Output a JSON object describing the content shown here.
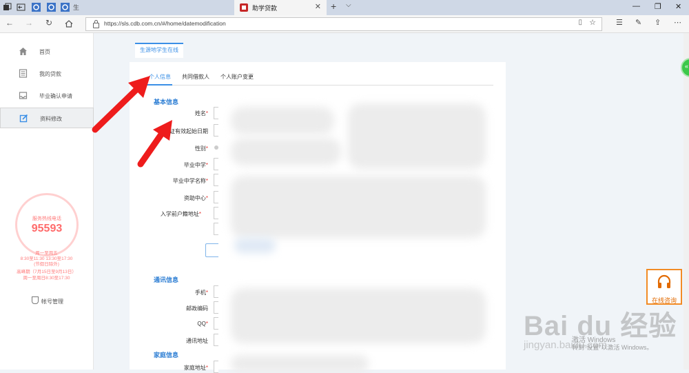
{
  "browser": {
    "active_tab_title": "助学贷款",
    "blurred_tab_label": "生",
    "url": "https://sls.cdb.com.cn/#/home/datemodification"
  },
  "sidebar": {
    "items": [
      {
        "label": "首页",
        "icon": "home-icon"
      },
      {
        "label": "我的贷款",
        "icon": "document-icon"
      },
      {
        "label": "毕业确认申请",
        "icon": "inbox-icon"
      },
      {
        "label": "资料修改",
        "icon": "edit-icon",
        "active": true
      }
    ],
    "hotline_label": "服务热线电话",
    "hotline_number": "95593",
    "hours": [
      "周一至周五",
      "8:30至11:30 13:30至17:30",
      "(节假日除外)",
      "高峰期（7月15日至9月13日）",
      "周一至周日8:30至17:30"
    ],
    "account_label": "帐号管理"
  },
  "main": {
    "top_tab": "生源地学生在线",
    "subtabs": [
      "个人信息",
      "共同借款人",
      "个人账户变更"
    ],
    "sections": {
      "basic": "基本信息",
      "contact": "通讯信息",
      "family": "家庭信息"
    },
    "basic_fields": [
      "姓名",
      "身份证有效起始日期",
      "性别",
      "毕业中学",
      "毕业中学名称",
      "资助中心",
      "入学前户籍地址"
    ],
    "contact_fields": [
      "手机",
      "邮政编码",
      "QQ",
      "通讯地址"
    ],
    "family_fields": [
      "家庭地址"
    ]
  },
  "widgets": {
    "consult_label": "在线咨询",
    "watermark_brand": "Bai du 经验",
    "watermark_domain": "jingyan.baidu.com",
    "activate_line1": "激活 Windows",
    "activate_line2": "转到\"设置\"以激活 Windows。"
  },
  "colors": {
    "accent": "#3a8fe6",
    "section_title": "#2f7fd4",
    "required": "#e53935",
    "hotline": "#ff6b6b",
    "consult": "#f28b24",
    "annotation_arrow": "#ee1c1c"
  }
}
